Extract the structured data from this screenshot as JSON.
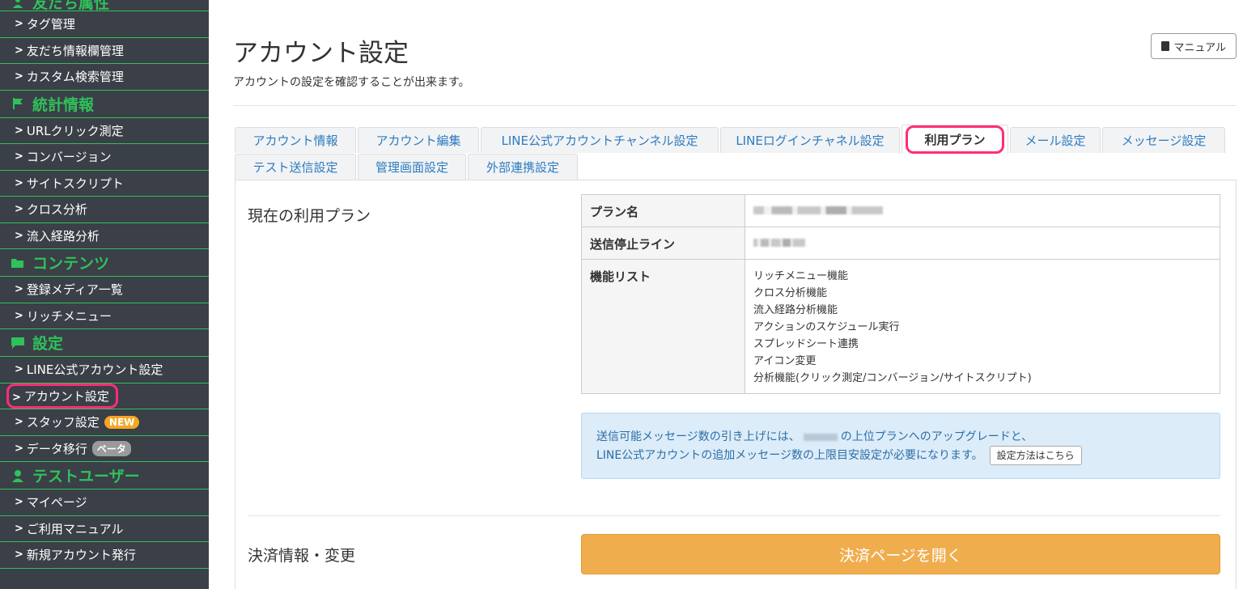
{
  "sidebar": {
    "sections": [
      {
        "icon": "person-icon",
        "title": "友だち属性",
        "items": [
          {
            "label": "タグ管理"
          },
          {
            "label": "友だち情報欄管理"
          },
          {
            "label": "カスタム検索管理"
          }
        ]
      },
      {
        "icon": "flag-icon",
        "title": "統計情報",
        "items": [
          {
            "label": "URLクリック測定"
          },
          {
            "label": "コンバージョン"
          },
          {
            "label": "サイトスクリプト"
          },
          {
            "label": "クロス分析"
          },
          {
            "label": "流入経路分析"
          }
        ]
      },
      {
        "icon": "folder-icon",
        "title": "コンテンツ",
        "items": [
          {
            "label": "登録メディア一覧"
          },
          {
            "label": "リッチメニュー"
          }
        ]
      },
      {
        "icon": "chat-icon",
        "title": "設定",
        "items": [
          {
            "label": "LINE公式アカウント設定"
          },
          {
            "label": "アカウント設定"
          },
          {
            "label": "スタッフ設定",
            "badge": "NEW"
          },
          {
            "label": "データ移行",
            "badge": "ベータ"
          }
        ]
      },
      {
        "icon": "user-icon",
        "title": "テストユーザー",
        "items": [
          {
            "label": "マイページ"
          },
          {
            "label": "ご利用マニュアル"
          },
          {
            "label": "新規アカウント発行"
          }
        ]
      }
    ]
  },
  "header": {
    "title": "アカウント設定",
    "subtitle": "アカウントの設定を確認することが出来ます。",
    "manual_label": "マニュアル"
  },
  "tabs": [
    "アカウント情報",
    "アカウント編集",
    "LINE公式アカウントチャンネル設定",
    "LINEログインチャネル設定",
    "利用プラン",
    "メール設定",
    "メッセージ設定",
    "テスト送信設定",
    "管理画面設定",
    "外部連携設定"
  ],
  "plan": {
    "section_title": "現在の利用プラン",
    "label_name": "プラン名",
    "label_stop": "送信停止ライン",
    "label_features": "機能リスト",
    "features": [
      "リッチメニュー機能",
      "クロス分析機能",
      "流入経路分析機能",
      "アクションのスケジュール実行",
      "スプレッドシート連携",
      "アイコン変更",
      "分析機能(クリック測定/コンバージョン/サイトスクリプト)"
    ]
  },
  "info": {
    "line1_before": "送信可能メッセージ数の引き上げには、",
    "line1_after": "の上位プランへのアップグレードと、",
    "line2": "LINE公式アカウントの追加メッセージ数の上限目安設定が必要になります。",
    "button": "設定方法はこちら"
  },
  "payment": {
    "section_title": "決済情報・変更",
    "button": "決済ページを開く"
  },
  "colors": {
    "sidebar_bg": "#3b3f47",
    "accent_green": "#2ec25a",
    "highlight_pink": "#ff2d78",
    "link_blue": "#2c7bbf",
    "pay_orange": "#f0ad4e"
  }
}
